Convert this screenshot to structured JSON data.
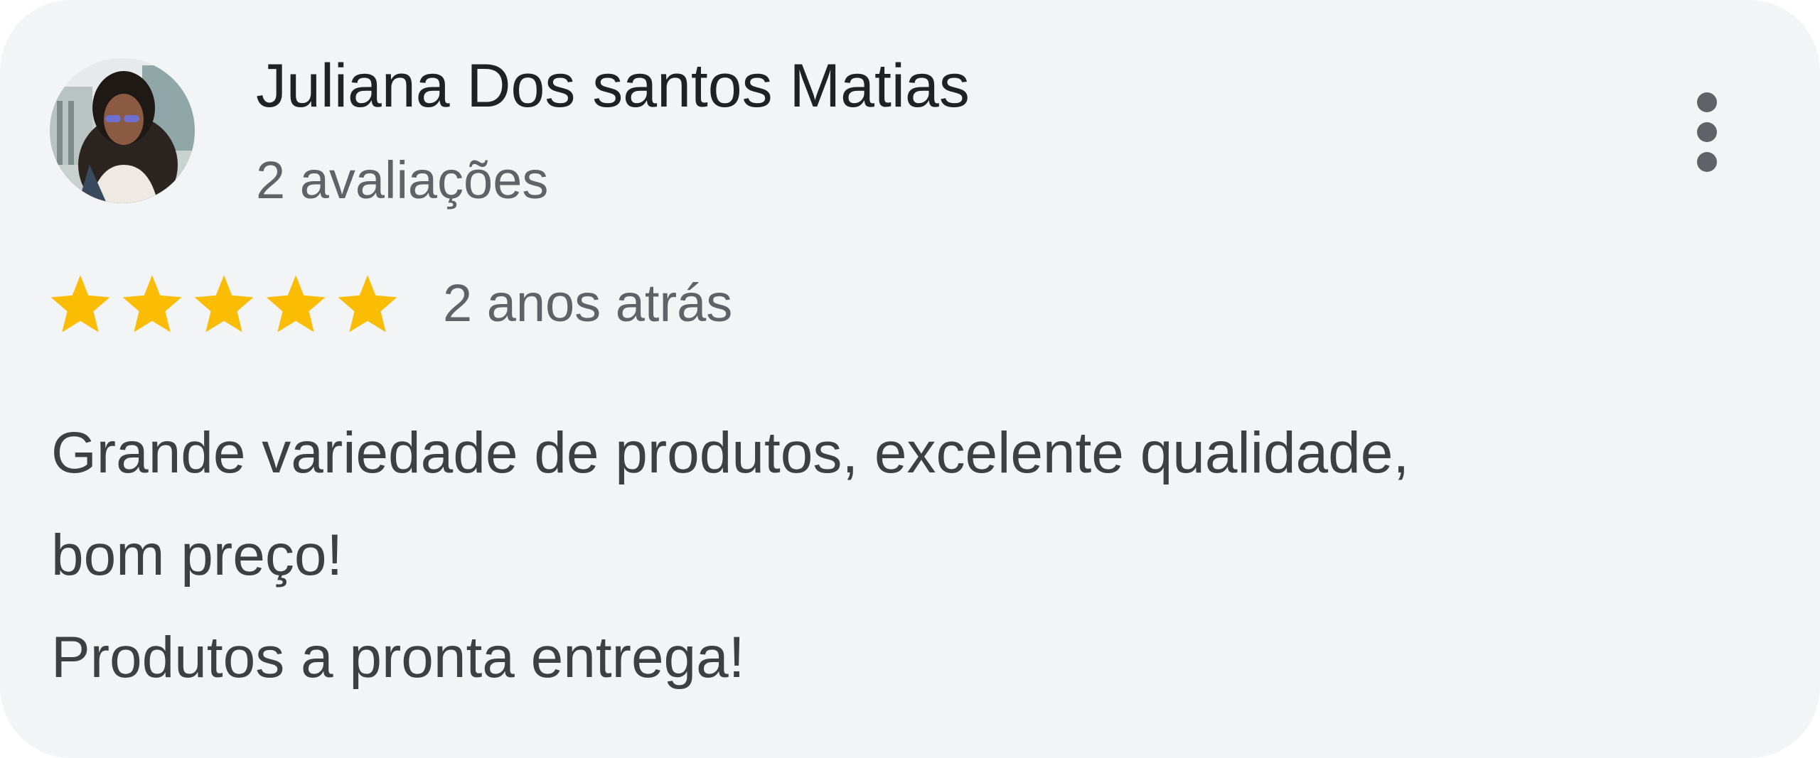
{
  "review": {
    "author_name": "Juliana Dos santos Matias",
    "review_count_text": "2 avaliações",
    "rating": 5,
    "rating_max": 5,
    "time_text": "2 anos atrás",
    "body_lines": [
      "Grande variedade de produtos, excelente qualidade,",
      "bom preço!",
      "Produtos a pronta entrega!"
    ]
  },
  "icons": {
    "avatar": "user-avatar-photo",
    "menu": "more-vert-icon",
    "star": "star-filled-icon"
  },
  "colors": {
    "card_background": "#f3f4f6",
    "star": "#fbbc04",
    "name_text": "#202124",
    "secondary_text": "#5f6368",
    "body_text": "#3c4043",
    "menu_icon": "#5f6368"
  }
}
